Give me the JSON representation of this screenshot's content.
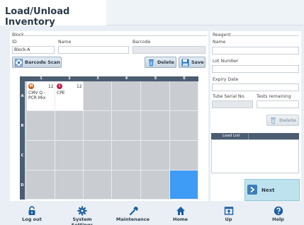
{
  "title": "Load/Unload Inventory",
  "block": {
    "group_label": "Block",
    "id_label": "ID",
    "id_value": "Block-A",
    "name_label": "Name",
    "name_value": "",
    "barcode_label": "Barcode",
    "barcode_value": ""
  },
  "toolbar": {
    "barcode_scan_label": "Barcode Scan",
    "delete_label": "Delete",
    "save_label": "Save"
  },
  "grid": {
    "columns": [
      "1",
      "2",
      "3",
      "4",
      "5",
      "6"
    ],
    "rows": [
      "A",
      "B",
      "C",
      "D"
    ],
    "cells": {
      "A1": {
        "badge": "M",
        "badge_color": "#d45a00",
        "count": "12",
        "line1": "CMV Q -",
        "line2": "PCR Mix"
      },
      "A2": {
        "badge": "I",
        "badge_color": "#c0204a",
        "count": "12",
        "line1": "CPE",
        "line2": ""
      }
    },
    "selected_cell": "D6",
    "selected_color": "#3e9bf6"
  },
  "reagent": {
    "group_label": "Reagent",
    "name_label": "Name",
    "name_value": "",
    "lot_label": "Lot Number",
    "lot_value": "",
    "expiry_label": "Expiry Date",
    "expiry_value": "",
    "tube_serial_label": "Tube Serial No.",
    "tube_serial_value": "",
    "tests_remaining_label": "Tests remaining",
    "tests_remaining_value": "",
    "delete_label": "Delete"
  },
  "load_list": {
    "header": "Load List"
  },
  "next_label": "Next",
  "footer": {
    "logout": "Log out",
    "system_settings": "System Settings",
    "maintenance": "Maintenance",
    "home": "Home",
    "up": "Up",
    "help": "Help"
  }
}
